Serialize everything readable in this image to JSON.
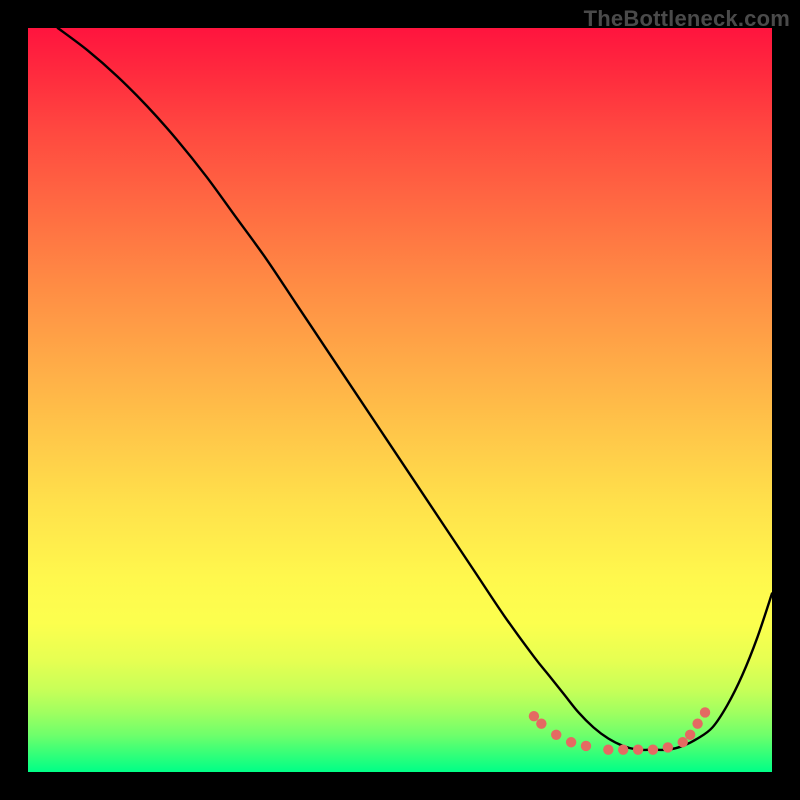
{
  "watermark": "TheBottleneck.com",
  "colors": {
    "frame_bg_top": "#ff143e",
    "frame_bg_bottom": "#00ff87",
    "page_bg": "#000000",
    "curve": "#000000",
    "markers": "#e46a62"
  },
  "chart_data": {
    "type": "line",
    "title": "",
    "xlabel": "",
    "ylabel": "",
    "xlim": [
      0,
      100
    ],
    "ylim": [
      0,
      100
    ],
    "grid": false,
    "legend": false,
    "series": [
      {
        "name": "bottleneck-curve",
        "x": [
          4,
          8,
          12,
          16,
          20,
          24,
          28,
          32,
          36,
          40,
          44,
          48,
          52,
          56,
          60,
          64,
          68,
          70,
          72,
          74,
          76,
          78,
          80,
          82,
          84,
          86,
          88,
          90,
          92,
          94,
          96,
          98,
          100
        ],
        "y": [
          100,
          97,
          93.5,
          89.5,
          85,
          80,
          74.5,
          69,
          63,
          57,
          51,
          45,
          39,
          33,
          27,
          21,
          15.5,
          13,
          10.5,
          8,
          6,
          4.5,
          3.5,
          3,
          3,
          3,
          3.5,
          4.5,
          6,
          9,
          13,
          18,
          24
        ]
      }
    ],
    "markers": {
      "name": "highlight-dots",
      "points": [
        {
          "x": 68,
          "y": 7.5
        },
        {
          "x": 69,
          "y": 6.5
        },
        {
          "x": 71,
          "y": 5
        },
        {
          "x": 73,
          "y": 4
        },
        {
          "x": 75,
          "y": 3.5
        },
        {
          "x": 78,
          "y": 3
        },
        {
          "x": 80,
          "y": 3
        },
        {
          "x": 82,
          "y": 3
        },
        {
          "x": 84,
          "y": 3
        },
        {
          "x": 86,
          "y": 3.3
        },
        {
          "x": 88,
          "y": 4
        },
        {
          "x": 89,
          "y": 5
        },
        {
          "x": 90,
          "y": 6.5
        },
        {
          "x": 91,
          "y": 8
        }
      ]
    }
  }
}
